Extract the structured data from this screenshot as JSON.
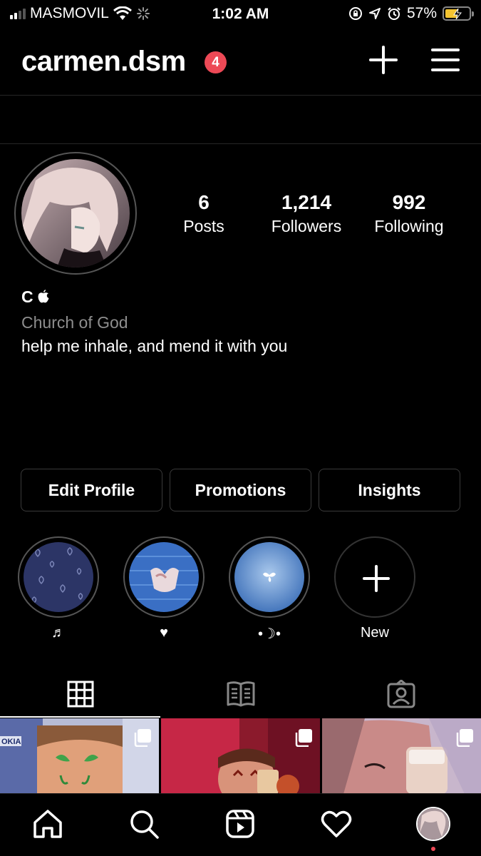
{
  "status_bar": {
    "carrier": "MASMOVIL",
    "time": "1:02 AM",
    "battery": "57%",
    "battery_level": 0.57
  },
  "header": {
    "username": "carmen.dsm",
    "notification_count": "4",
    "add_icon": "plus-icon",
    "menu_icon": "hamburger-menu-icon"
  },
  "profile": {
    "stats": [
      {
        "value": "6",
        "label": "Posts"
      },
      {
        "value": "1,214",
        "label": "Followers"
      },
      {
        "value": "992",
        "label": "Following"
      }
    ],
    "name": "C ",
    "category": "Church of God",
    "bio": "help me inhale, and mend it with you"
  },
  "buttons": {
    "edit_profile": "Edit Profile",
    "promotions": "Promotions",
    "insights": "Insights"
  },
  "highlights": [
    {
      "caption": "♬"
    },
    {
      "caption": "♥"
    },
    {
      "caption": "•☽•"
    },
    {
      "caption": "New"
    }
  ],
  "tabs": [
    "grid-icon",
    "guide-icon",
    "tagged-icon"
  ],
  "posts": [
    {
      "sign_text": "OKIA"
    },
    {},
    {}
  ],
  "colors": {
    "background": "#000000",
    "badge": "#ed4956",
    "secondary_text": "#8e8e8e",
    "border": "#3a3a3a",
    "battery": "#f4c430"
  }
}
